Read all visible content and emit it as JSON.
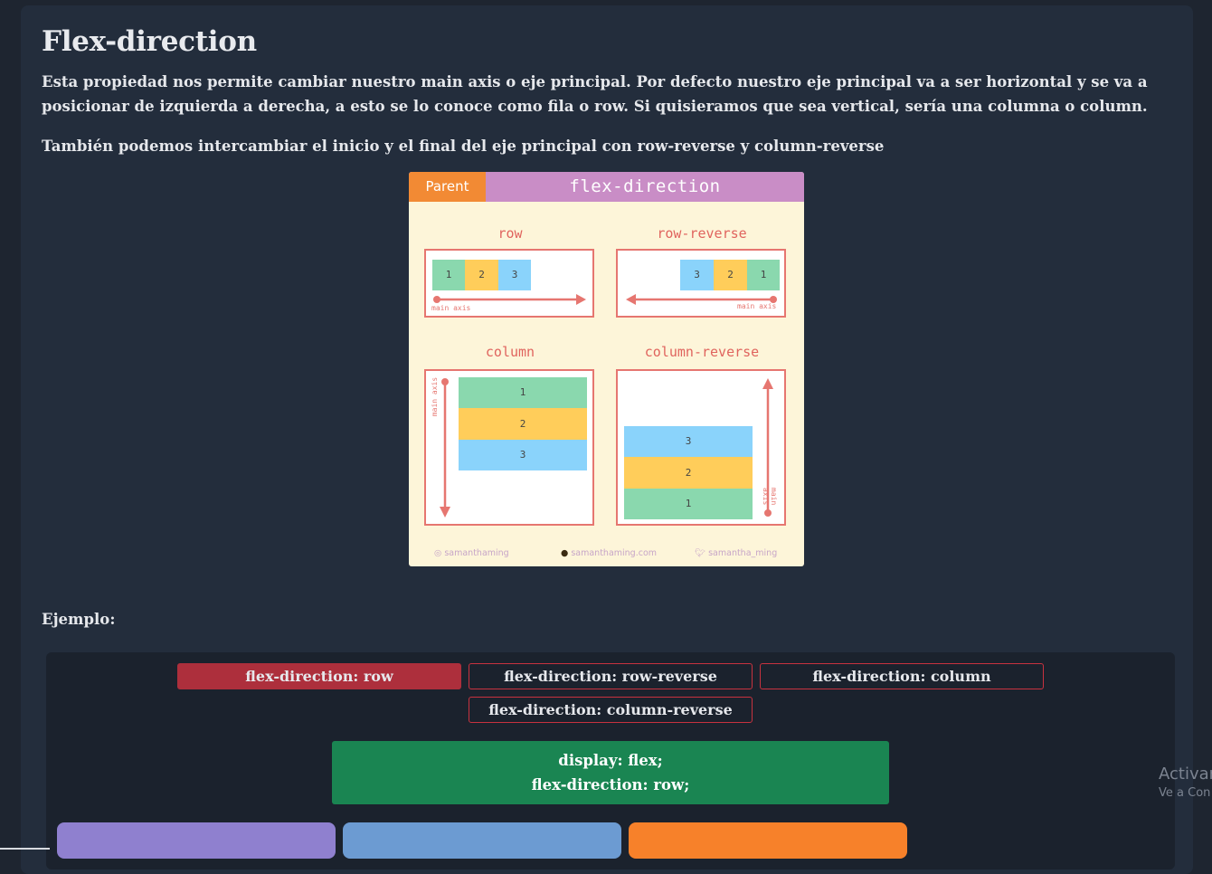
{
  "section": {
    "title": "Flex-direction",
    "paragraph1": "Esta propiedad nos permite cambiar nuestro main axis o eje principal. Por defecto nuestro eje principal va a ser horizontal y se va a posicionar de izquierda a derecha, a esto se lo conoce como fila o row. Si quisieramos que sea vertical, sería una columna o column.",
    "paragraph2": "También podemos intercambiar el inicio y el final del eje principal con row-reverse y column-reverse"
  },
  "figure": {
    "parent_tag": "Parent",
    "title": "flex-direction",
    "axis_label": "main axis",
    "panels": {
      "row": {
        "label": "row",
        "items": [
          "1",
          "2",
          "3"
        ]
      },
      "row_reverse": {
        "label": "row-reverse",
        "items": [
          "3",
          "2",
          "1"
        ]
      },
      "column": {
        "label": "column",
        "items": [
          "1",
          "2",
          "3"
        ]
      },
      "column_reverse": {
        "label": "column-reverse",
        "items": [
          "3",
          "2",
          "1"
        ]
      }
    },
    "footer": {
      "instagram": "samanthaming",
      "website": "samanthaming.com",
      "twitter": "samantha_ming"
    },
    "colors": {
      "accent_orange": "#f28a34",
      "accent_purple": "#c98dc6",
      "axis_red": "#e67670"
    }
  },
  "example": {
    "label": "Ejemplo:",
    "options": [
      {
        "label": "flex-direction: row",
        "active": true
      },
      {
        "label": "flex-direction: row-reverse",
        "active": false
      },
      {
        "label": "flex-direction: column",
        "active": false
      },
      {
        "label": "flex-direction: column-reverse",
        "active": false
      }
    ],
    "code_line1": "display: flex;",
    "code_line2": "flex-direction: row;",
    "box_colors": [
      "#8f80cf",
      "#6c9bd2",
      "#f7812a"
    ]
  },
  "watermark": {
    "line1": "Activar",
    "line2": "Ve a Con"
  }
}
